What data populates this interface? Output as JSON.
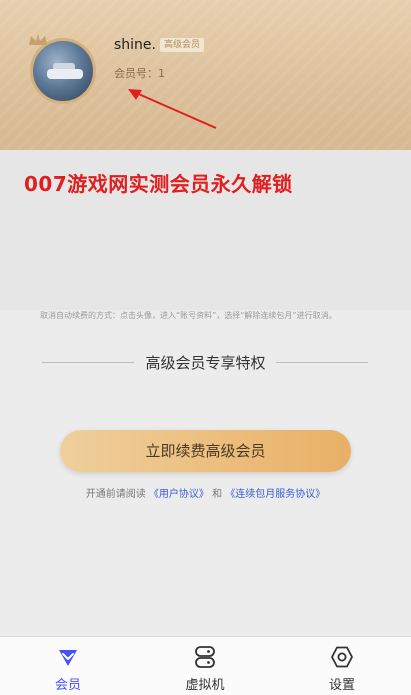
{
  "profile": {
    "username": "shine.",
    "member_tag": "高级会员",
    "member_number_label": "会员号：",
    "member_number": "1"
  },
  "banner": {
    "title": "007游戏网实测会员永久解锁"
  },
  "notes": {
    "cancel_hint": "取消自动续费的方式：点击头像，进入“账号资料”，选择“解除连续包月”进行取消。"
  },
  "section": {
    "title": "高级会员专享特权"
  },
  "cta": {
    "button_label": "立即续费高级会员"
  },
  "agreement": {
    "prefix": "开通前请阅读",
    "user_agreement": "《用户协议》",
    "and": "和",
    "monthly_agreement": "《连续包月服务协议》"
  },
  "tabbar": {
    "tabs": [
      {
        "label": "会员",
        "icon": "diamond-icon",
        "active": true
      },
      {
        "label": "虚拟机",
        "icon": "server-icon",
        "active": false
      },
      {
        "label": "设置",
        "icon": "hexagon-settings-icon",
        "active": false
      }
    ]
  },
  "colors": {
    "accent": "#4451ff",
    "header_gold": "#dcc09b",
    "cta_start": "#efcf9c",
    "cta_end": "#e9b066",
    "banner_red": "#e02020"
  }
}
